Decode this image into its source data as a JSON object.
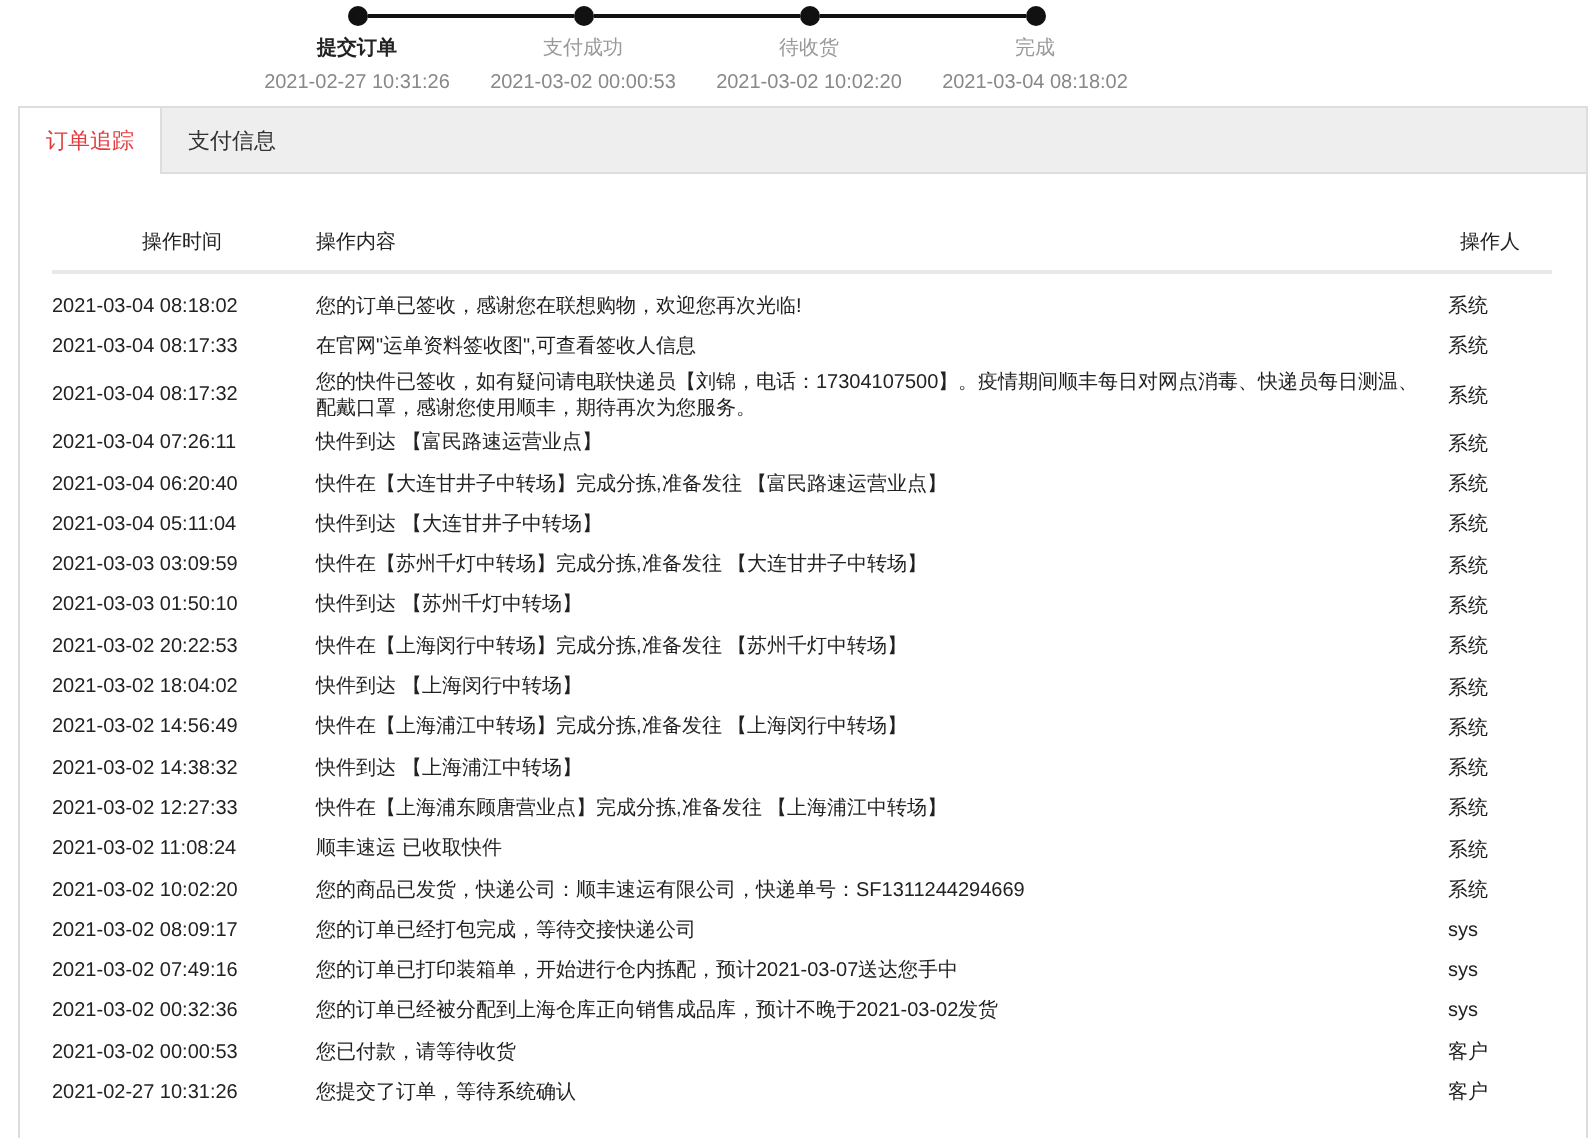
{
  "steps": [
    {
      "label": "提交订单",
      "time": "2021-02-27 10:31:26",
      "current": true
    },
    {
      "label": "支付成功",
      "time": "2021-03-02 00:00:53",
      "current": false
    },
    {
      "label": "待收货",
      "time": "2021-03-02 10:02:20",
      "current": false
    },
    {
      "label": "完成",
      "time": "2021-03-04 08:18:02",
      "current": false
    }
  ],
  "tabs": [
    {
      "label": "订单追踪",
      "selected": true
    },
    {
      "label": "支付信息",
      "selected": false
    }
  ],
  "table": {
    "columns": [
      "操作时间",
      "操作内容",
      "操作人"
    ],
    "rows": [
      [
        "2021-03-04 08:18:02",
        "您的订单已签收，感谢您在联想购物，欢迎您再次光临!",
        "系统"
      ],
      [
        "2021-03-04 08:17:33",
        "在官网\"运单资料签收图\",可查看签收人信息",
        "系统"
      ],
      [
        "2021-03-04 08:17:32",
        "您的快件已签收，如有疑问请电联快递员【刘锦，电话：17304107500】。疫情期间顺丰每日对网点消毒、快递员每日测温、配戴口罩，感谢您使用顺丰，期待再次为您服务。",
        "系统"
      ],
      [
        "2021-03-04 07:26:11",
        "快件到达 【富民路速运营业点】",
        "系统"
      ],
      [
        "2021-03-04 06:20:40",
        "快件在【大连甘井子中转场】完成分拣,准备发往 【富民路速运营业点】",
        "系统"
      ],
      [
        "2021-03-04 05:11:04",
        "快件到达 【大连甘井子中转场】",
        "系统"
      ],
      [
        "2021-03-03 03:09:59",
        "快件在【苏州千灯中转场】完成分拣,准备发往 【大连甘井子中转场】",
        "系统"
      ],
      [
        "2021-03-03 01:50:10",
        "快件到达 【苏州千灯中转场】",
        "系统"
      ],
      [
        "2021-03-02 20:22:53",
        "快件在【上海闵行中转场】完成分拣,准备发往 【苏州千灯中转场】",
        "系统"
      ],
      [
        "2021-03-02 18:04:02",
        "快件到达 【上海闵行中转场】",
        "系统"
      ],
      [
        "2021-03-02 14:56:49",
        "快件在【上海浦江中转场】完成分拣,准备发往 【上海闵行中转场】",
        "系统"
      ],
      [
        "2021-03-02 14:38:32",
        "快件到达 【上海浦江中转场】",
        "系统"
      ],
      [
        "2021-03-02 12:27:33",
        "快件在【上海浦东顾唐营业点】完成分拣,准备发往 【上海浦江中转场】",
        "系统"
      ],
      [
        "2021-03-02 11:08:24",
        "顺丰速运 已收取快件",
        "系统"
      ],
      [
        "2021-03-02 10:02:20",
        "您的商品已发货，快递公司：顺丰速运有限公司，快递单号：SF1311244294669",
        "系统"
      ],
      [
        "2021-03-02 08:09:17",
        "您的订单已经打包完成，等待交接快递公司",
        "sys"
      ],
      [
        "2021-03-02 07:49:16",
        "您的订单已打印装箱单，开始进行仓内拣配，预计2021-03-07送达您手中",
        "sys"
      ],
      [
        "2021-03-02 00:32:36",
        "您的订单已经被分配到上海仓库正向销售成品库，预计不晚于2021-03-02发货",
        "sys"
      ],
      [
        "2021-03-02 00:00:53",
        "您已付款，请等待收货",
        "客户"
      ],
      [
        "2021-02-27 10:31:26",
        "您提交了订单，等待系统确认",
        "客户"
      ]
    ]
  }
}
